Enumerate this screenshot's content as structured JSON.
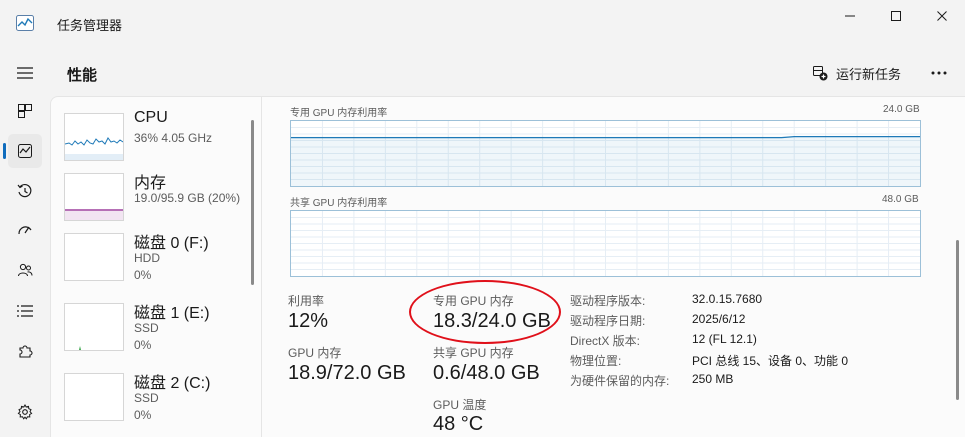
{
  "window": {
    "title": "任务管理器"
  },
  "header": {
    "page_title": "性能",
    "run_task_label": "运行新任务",
    "more_label": "···"
  },
  "devices": [
    {
      "name": "CPU",
      "sub1": "36%  4.05 GHz",
      "sub2": ""
    },
    {
      "name": "内存",
      "sub1": "19.0/95.9 GB (20%)",
      "sub2": ""
    },
    {
      "name": "磁盘 0 (F:)",
      "sub1": "HDD",
      "sub2": "0%"
    },
    {
      "name": "磁盘 1 (E:)",
      "sub1": "SSD",
      "sub2": "0%"
    },
    {
      "name": "磁盘 2 (C:)",
      "sub1": "SSD",
      "sub2": "0%"
    }
  ],
  "graphs": {
    "dedicated": {
      "label": "专用 GPU 内存利用率",
      "max": "24.0 GB",
      "fill_fraction": 0.76
    },
    "shared": {
      "label": "共享 GPU 内存利用率",
      "max": "48.0 GB",
      "fill_fraction": 0.0
    }
  },
  "stats": {
    "utilization": {
      "label": "利用率",
      "value": "12%"
    },
    "dedicated_mem": {
      "label": "专用 GPU 内存",
      "value": "18.3/24.0 GB"
    },
    "gpu_mem": {
      "label": "GPU 内存",
      "value": "18.9/72.0 GB"
    },
    "shared_mem": {
      "label": "共享 GPU 内存",
      "value": "0.6/48.0 GB"
    },
    "temperature": {
      "label": "GPU 温度",
      "value": "48 °C"
    }
  },
  "details": [
    {
      "label": "驱动程序版本:",
      "value": "32.0.15.7680"
    },
    {
      "label": "驱动程序日期:",
      "value": "2025/6/12"
    },
    {
      "label": "DirectX 版本:",
      "value": "12 (FL 12.1)"
    },
    {
      "label": "物理位置:",
      "value": "PCI 总线 15、设备 0、功能 0"
    },
    {
      "label": "为硬件保留的内存:",
      "value": "250 MB"
    }
  ],
  "colors": {
    "accent": "#0f6cbd",
    "cpu_line": "#1f7ab8",
    "memory_line": "#8b1a8b",
    "disk_line": "#3aa64a",
    "graph_border": "#9cc0d8",
    "annotation": "#e0101a"
  }
}
